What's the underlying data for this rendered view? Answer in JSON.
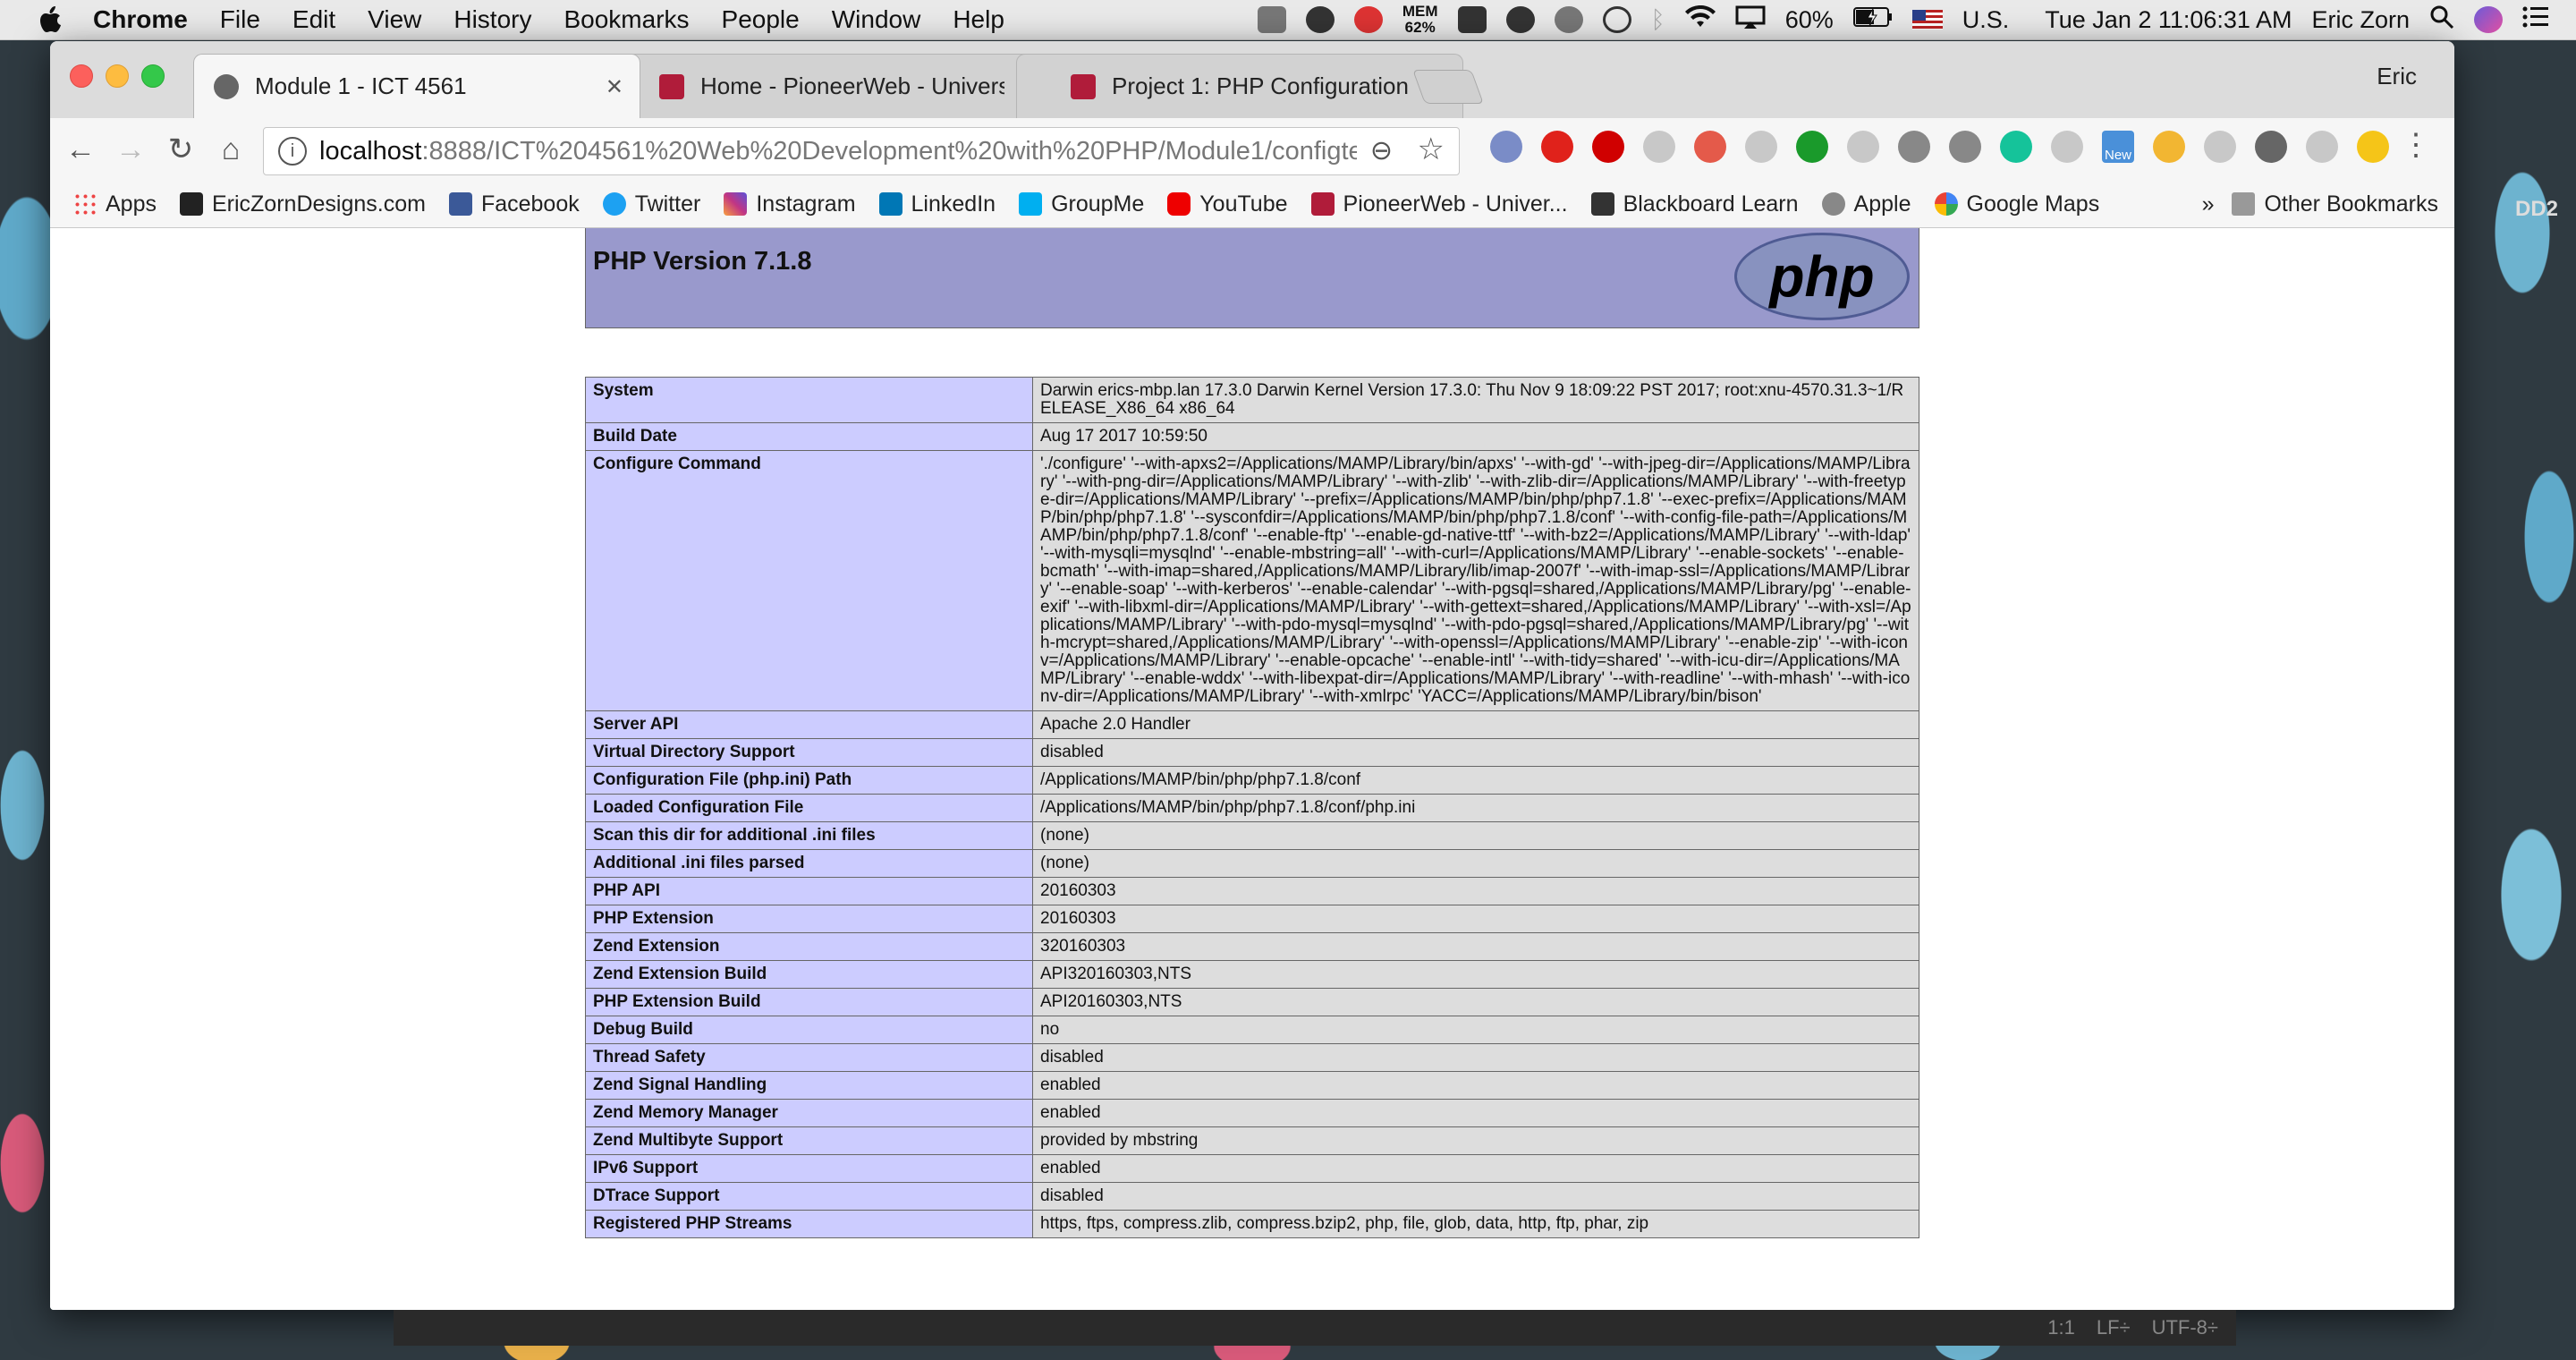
{
  "menubar": {
    "app": "Chrome",
    "items": [
      "File",
      "Edit",
      "View",
      "History",
      "Bookmarks",
      "People",
      "Window",
      "Help"
    ],
    "mem_label": "MEM",
    "mem_value": "62%",
    "battery": "60%",
    "input_source": "U.S.",
    "clock": "Tue Jan 2  11:06:31 AM",
    "user": "Eric Zorn"
  },
  "tabs": [
    {
      "title": "Module 1 - ICT 4561",
      "color": "#666666"
    },
    {
      "title": "Home - PioneerWeb - University",
      "color": "#b01c3a"
    },
    {
      "title": "Project 1: PHP Configuration",
      "color": "#b01c3a"
    }
  ],
  "profile_name": "Eric",
  "toolbar": {
    "url_host": "localhost",
    "url_path": ":8888/ICT%204561%20Web%20Development%20with%20PHP/Module1/configte..."
  },
  "extensions": [
    {
      "name": "eyedropper-icon",
      "color": "#7a8cc7"
    },
    {
      "name": "opera-icon",
      "color": "#e0221b"
    },
    {
      "name": "adblock-icon",
      "color": "#d00000"
    },
    {
      "name": "dropbox-icon",
      "color": "#c8c8c8"
    },
    {
      "name": "calendar-icon",
      "color": "#e45a4a"
    },
    {
      "name": "skype-icon",
      "color": "#c8c8c8"
    },
    {
      "name": "check-icon",
      "color": "#1a9a2b"
    },
    {
      "name": "drive-icon",
      "color": "#c8c8c8"
    },
    {
      "name": "info-icon",
      "color": "#888888"
    },
    {
      "name": "notes-icon",
      "color": "#888888"
    },
    {
      "name": "grammarly-icon",
      "color": "#15c39a"
    },
    {
      "name": "translate-icon",
      "color": "#c8c8c8"
    },
    {
      "name": "new-badge-icon",
      "color": "#4a90d9"
    },
    {
      "name": "diamond-icon",
      "color": "#f2b632"
    },
    {
      "name": "chat-icon",
      "color": "#c8c8c8"
    },
    {
      "name": "cast-icon",
      "color": "#666666"
    },
    {
      "name": "pocket-icon",
      "color": "#c8c8c8"
    },
    {
      "name": "moon-icon",
      "color": "#f5c518"
    }
  ],
  "new_badge_label": "New",
  "bookmarks": [
    {
      "label": "Apps",
      "color": "#e44"
    },
    {
      "label": "EricZornDesigns.com",
      "color": "#222"
    },
    {
      "label": "Facebook",
      "color": "#3b5998"
    },
    {
      "label": "Twitter",
      "color": "#1da1f2"
    },
    {
      "label": "Instagram",
      "color": "#c13584"
    },
    {
      "label": "LinkedIn",
      "color": "#0077b5"
    },
    {
      "label": "GroupMe",
      "color": "#00aff0"
    },
    {
      "label": "YouTube",
      "color": "#e00"
    },
    {
      "label": "PioneerWeb - Univer...",
      "color": "#b01c3a"
    },
    {
      "label": "Blackboard Learn",
      "color": "#333"
    },
    {
      "label": "Apple",
      "color": "#888"
    },
    {
      "label": "Google Maps",
      "color": "#4285f4"
    }
  ],
  "bookmarks_more": "»",
  "other_bookmarks": "Other Bookmarks",
  "php": {
    "version_title": "PHP Version 7.1.8",
    "logo_text": "php",
    "rows": [
      {
        "key": "System",
        "value": "Darwin erics-mbp.lan 17.3.0 Darwin Kernel Version 17.3.0: Thu Nov 9 18:09:22 PST 2017; root:xnu-4570.31.3~1/RELEASE_X86_64 x86_64"
      },
      {
        "key": "Build Date",
        "value": "Aug 17 2017 10:59:50"
      },
      {
        "key": "Configure Command",
        "value": "'./configure' '--with-apxs2=/Applications/MAMP/Library/bin/apxs' '--with-gd' '--with-jpeg-dir=/Applications/MAMP/Library' '--with-png-dir=/Applications/MAMP/Library' '--with-zlib' '--with-zlib-dir=/Applications/MAMP/Library' '--with-freetype-dir=/Applications/MAMP/Library' '--prefix=/Applications/MAMP/bin/php/php7.1.8' '--exec-prefix=/Applications/MAMP/bin/php/php7.1.8' '--sysconfdir=/Applications/MAMP/bin/php/php7.1.8/conf' '--with-config-file-path=/Applications/MAMP/bin/php/php7.1.8/conf' '--enable-ftp' '--enable-gd-native-ttf' '--with-bz2=/Applications/MAMP/Library' '--with-ldap' '--with-mysqli=mysqlnd' '--enable-mbstring=all' '--with-curl=/Applications/MAMP/Library' '--enable-sockets' '--enable-bcmath' '--with-imap=shared,/Applications/MAMP/Library/lib/imap-2007f' '--with-imap-ssl=/Applications/MAMP/Library' '--enable-soap' '--with-kerberos' '--enable-calendar' '--with-pgsql=shared,/Applications/MAMP/Library/pg' '--enable-exif' '--with-libxml-dir=/Applications/MAMP/Library' '--with-gettext=shared,/Applications/MAMP/Library' '--with-xsl=/Applications/MAMP/Library' '--with-pdo-mysql=mysqlnd' '--with-pdo-pgsql=shared,/Applications/MAMP/Library/pg' '--with-mcrypt=shared,/Applications/MAMP/Library' '--with-openssl=/Applications/MAMP/Library' '--enable-zip' '--with-iconv=/Applications/MAMP/Library' '--enable-opcache' '--enable-intl' '--with-tidy=shared' '--with-icu-dir=/Applications/MAMP/Library' '--enable-wddx' '--with-libexpat-dir=/Applications/MAMP/Library' '--with-readline' '--with-mhash' '--with-iconv-dir=/Applications/MAMP/Library' '--with-xmlrpc' 'YACC=/Applications/MAMP/Library/bin/bison'"
      },
      {
        "key": "Server API",
        "value": "Apache 2.0 Handler"
      },
      {
        "key": "Virtual Directory Support",
        "value": "disabled"
      },
      {
        "key": "Configuration File (php.ini) Path",
        "value": "/Applications/MAMP/bin/php/php7.1.8/conf"
      },
      {
        "key": "Loaded Configuration File",
        "value": "/Applications/MAMP/bin/php/php7.1.8/conf/php.ini"
      },
      {
        "key": "Scan this dir for additional .ini files",
        "value": "(none)"
      },
      {
        "key": "Additional .ini files parsed",
        "value": "(none)"
      },
      {
        "key": "PHP API",
        "value": "20160303"
      },
      {
        "key": "PHP Extension",
        "value": "20160303"
      },
      {
        "key": "Zend Extension",
        "value": "320160303"
      },
      {
        "key": "Zend Extension Build",
        "value": "API320160303,NTS"
      },
      {
        "key": "PHP Extension Build",
        "value": "API20160303,NTS"
      },
      {
        "key": "Debug Build",
        "value": "no"
      },
      {
        "key": "Thread Safety",
        "value": "disabled"
      },
      {
        "key": "Zend Signal Handling",
        "value": "enabled"
      },
      {
        "key": "Zend Memory Manager",
        "value": "enabled"
      },
      {
        "key": "Zend Multibyte Support",
        "value": "provided by mbstring"
      },
      {
        "key": "IPv6 Support",
        "value": "enabled"
      },
      {
        "key": "DTrace Support",
        "value": "disabled"
      },
      {
        "key": "Registered PHP Streams",
        "value": "https, ftps, compress.zlib, compress.bzip2, php, file, glob, data, http, ftp, phar, zip"
      }
    ]
  },
  "editor_status": {
    "position": "1:1",
    "line_ending": "LF÷",
    "encoding": "UTF-8÷"
  },
  "dock_label": "DD2"
}
